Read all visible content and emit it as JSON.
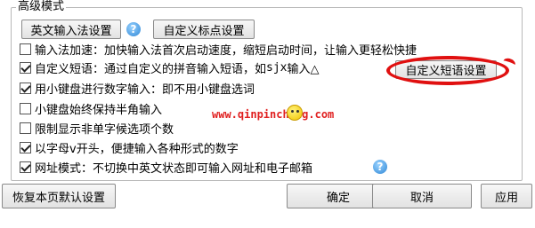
{
  "group": {
    "title": "高级模式"
  },
  "top_buttons": {
    "english_ime": "英文输入法设置",
    "custom_punct": "自定义标点设置"
  },
  "options": [
    {
      "label": "输入法加速：加快输入法首次启动速度，缩短启动时间，让输入更轻松快捷",
      "checked": false
    },
    {
      "label_pre": "自定义短语：通过自定义的拼音输入短语，如 ",
      "label_code": "sjx",
      "label_post": " 输入△",
      "checked": true
    },
    {
      "label": "用小键盘进行数字输入：即不用小键盘选词",
      "checked": true
    },
    {
      "label": "小键盘始终保持半角输入",
      "checked": false
    },
    {
      "label": "限制显示非单字候选项个数",
      "checked": false
    },
    {
      "label": "以字母v开头，便捷输入各种形式的数字",
      "checked": true
    },
    {
      "label": "网址模式：不切换中英文状态即可输入网址和电子邮箱",
      "checked": true
    }
  ],
  "custom_phrase_button": "自定义短语设置",
  "watermark": "www.qinpinchang.com",
  "footer": {
    "restore": "恢复本页默认设置",
    "ok": "确定",
    "cancel": "取消",
    "apply": "应用"
  },
  "icons": {
    "help": "question-mark-help-icon",
    "smiley": "smiley-icon"
  },
  "colors": {
    "accent_red": "#e01010",
    "help_blue": "#2f87d6"
  }
}
